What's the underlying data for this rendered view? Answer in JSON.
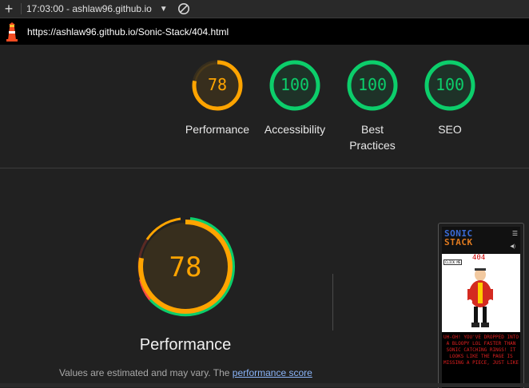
{
  "toolbar": {
    "report_label": "17:03:00 - ashlaw96.github.io"
  },
  "urlbar": {
    "url": "https://ashlaw96.github.io/Sonic-Stack/404.html"
  },
  "colors": {
    "average": "#ffa400",
    "pass": "#0cce6b",
    "fail": "#ff4e42"
  },
  "categories": [
    {
      "label": "Performance",
      "score": 78,
      "status": "average"
    },
    {
      "label": "Accessibility",
      "score": 100,
      "status": "pass"
    },
    {
      "label": "Best Practices",
      "score": 100,
      "status": "pass"
    },
    {
      "label": "SEO",
      "score": 100,
      "status": "pass"
    }
  ],
  "performance": {
    "score": 78,
    "label": "Performance",
    "note_prefix": "Values are estimated and may vary. The ",
    "note_link": "performance score"
  },
  "screenshot": {
    "title_line1": "SONIC",
    "title_line2": "STACK",
    "code": "404",
    "click_label": "CLICK ME",
    "message": "UH-OH! YOU'VE DROPPED INTO A BLOOPY LOL FASTER THAN SONIC CATCHING RINGS! IT LOOKS LIKE THE PAGE IS MISSING A PIECE, JUST LIKE"
  }
}
